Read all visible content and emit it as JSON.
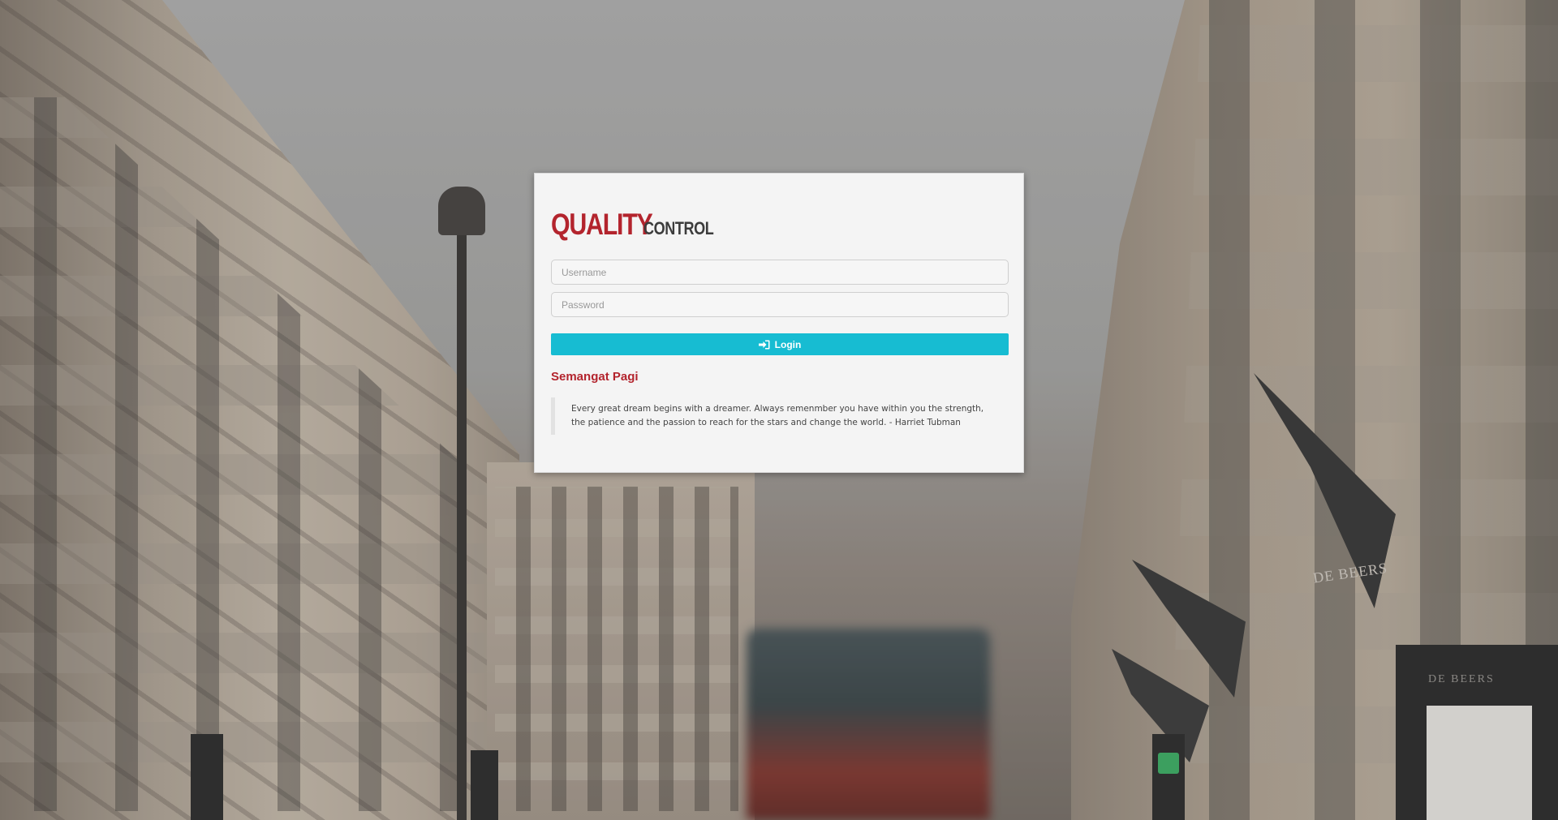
{
  "brand": {
    "logo_primary": "QUALITY",
    "logo_secondary": "CONTROL",
    "primary_color": "#b3242d",
    "secondary_color": "#3c3c3c"
  },
  "login_form": {
    "username_placeholder": "Username",
    "username_value": "",
    "password_placeholder": "Password",
    "password_value": "",
    "login_button_label": "Login",
    "login_button_icon": "sign-in-icon",
    "login_button_color": "#17bcd2"
  },
  "greeting": {
    "title": "Semangat Pagi",
    "quote": "Every great dream begins with a dreamer. Always remenmber you have within you the strength, the patience and the passion to reach for the stars and change the world. - Harriet Tubman"
  },
  "background": {
    "flag_text": "DE BEERS",
    "shop_sign_text": "DE BEERS"
  }
}
